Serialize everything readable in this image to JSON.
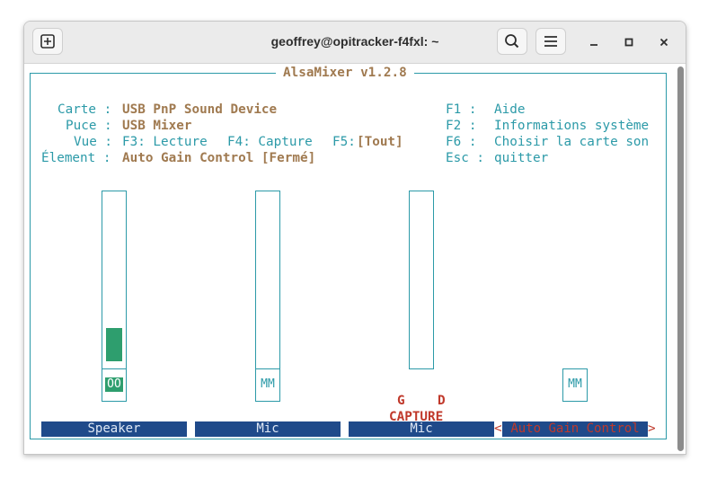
{
  "window": {
    "title": "geoffrey@opitracker-f4fxl: ~"
  },
  "icons": {
    "new_tab": "new-tab-icon",
    "search": "search-icon",
    "menu": "hamburger-menu-icon",
    "minimize": "minimize-icon",
    "maximize": "maximize-icon",
    "close": "close-icon"
  },
  "app": {
    "title": "AlsaMixer v1.2.8"
  },
  "info": {
    "card_label": "Carte :",
    "card_value": "USB PnP Sound Device",
    "chip_label": "Puce :",
    "chip_value": "USB Mixer",
    "view_label": "Vue :",
    "view_f3": "F3: Lecture",
    "view_f4": "F4: Capture",
    "view_f5_key": "F5:",
    "view_f5_val": "[Tout]",
    "element_label": "Élement :",
    "element_value": "Auto Gain Control [Fermé]"
  },
  "help": [
    {
      "key": "F1 :",
      "text": "Aide"
    },
    {
      "key": "F2 :",
      "text": "Informations système"
    },
    {
      "key": "F6 :",
      "text": "Choisir la carte son"
    },
    {
      "key": "Esc :",
      "text": "quitter"
    }
  ],
  "channels": [
    {
      "name": "Speaker",
      "level_percent": 19,
      "value_left": "19",
      "value_sep": "<>",
      "value_right": "19",
      "switch": "OO"
    },
    {
      "name": "Mic",
      "level_percent": 0,
      "value": "0",
      "switch": "MM"
    },
    {
      "name": "Mic",
      "level_percent": 0,
      "value": "0",
      "capture_left": "G",
      "capture_right": "D",
      "capture_label": "CAPTURE"
    },
    {
      "name": "Auto Gain Control",
      "selected": true,
      "left_marker": "<",
      "right_marker": ">",
      "switch": "MM"
    }
  ],
  "colors": {
    "accent_teal": "#2c9aa8",
    "label_brown": "#a07a50",
    "selected_red": "#c0392b",
    "channel_bar": "#1f4a8a",
    "meter_green": "#2e9e6e"
  }
}
